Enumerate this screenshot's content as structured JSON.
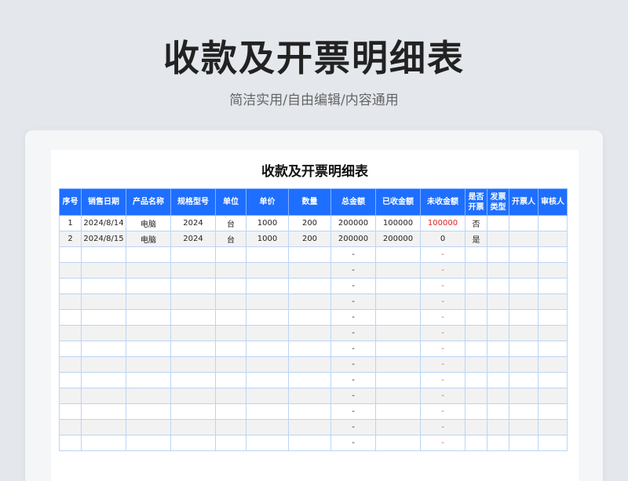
{
  "header": {
    "title": "收款及开票明细表",
    "subtitle": "简洁实用/自由编辑/内容通用"
  },
  "sheet": {
    "title": "收款及开票明细表",
    "columns": [
      "序号",
      "销售日期",
      "产品名称",
      "规格型号",
      "单位",
      "单价",
      "数量",
      "总金额",
      "已收金额",
      "未收金额",
      "是否开票",
      "发票类型",
      "开票人",
      "审核人"
    ],
    "rows": [
      [
        "1",
        "2024/8/14",
        "电脑",
        "2024",
        "台",
        "1000",
        "200",
        "200000",
        "100000",
        "100000",
        "否",
        "",
        "",
        ""
      ],
      [
        "2",
        "2024/8/15",
        "电脑",
        "2024",
        "台",
        "1000",
        "200",
        "200000",
        "200000",
        "0",
        "是",
        "",
        "",
        ""
      ]
    ],
    "empty_row_total": "-",
    "empty_row_unpaid": "-",
    "empty_row_count": 13,
    "colors": {
      "header_bg": "#1e6fff",
      "unpaid_highlight": "#e02020",
      "grid": "#bcd4f5"
    }
  }
}
